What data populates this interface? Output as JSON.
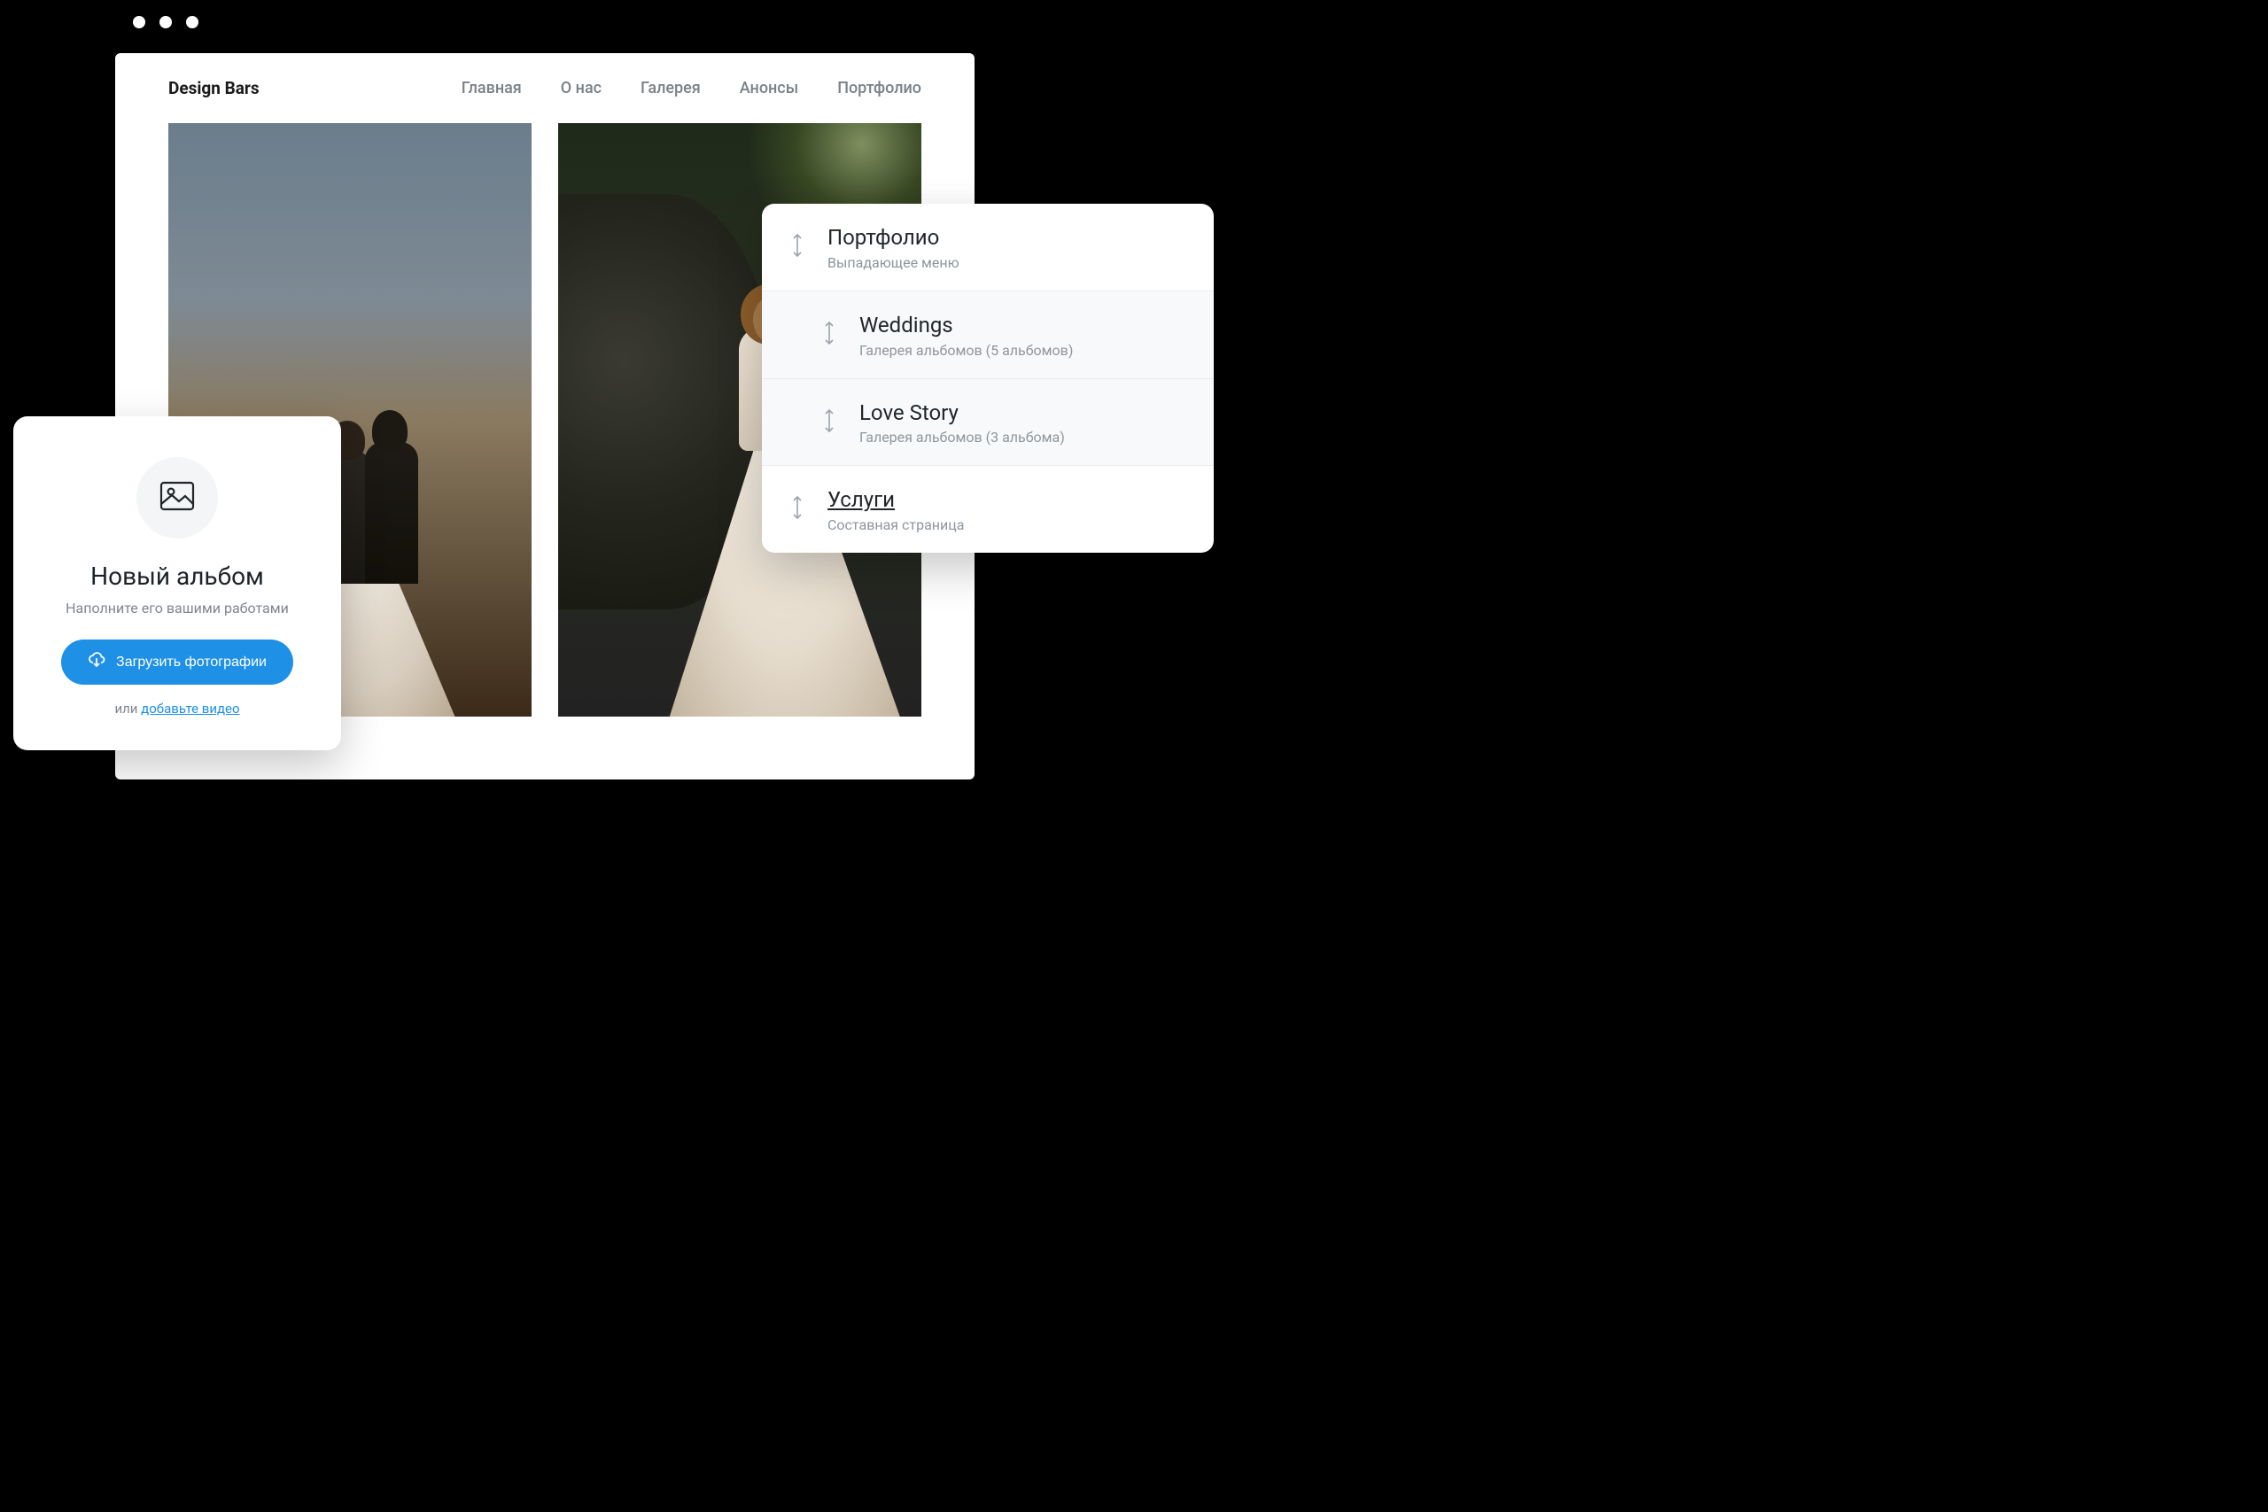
{
  "site": {
    "title": "Design Bars",
    "nav": [
      "Главная",
      "О нас",
      "Галерея",
      "Анонсы",
      "Портфолио"
    ]
  },
  "menu": {
    "items": [
      {
        "title": "Портфолио",
        "subtitle": "Выпадающее меню",
        "indent": false,
        "underlined": false
      },
      {
        "title": "Weddings",
        "subtitle": "Галерея альбомов (5 альбомов)",
        "indent": true,
        "underlined": false
      },
      {
        "title": "Love Story",
        "subtitle": "Галерея альбомов (3 альбома)",
        "indent": true,
        "underlined": false
      },
      {
        "title": "Услуги",
        "subtitle": "Составная страница",
        "indent": false,
        "underlined": true
      }
    ]
  },
  "album": {
    "title": "Новый альбом",
    "subtitle": "Наполните его вашими работами",
    "upload_label": "Загрузить фотографии",
    "or_prefix": "или ",
    "video_link": "добавьте видео"
  },
  "colors": {
    "accent": "#1e90e6"
  }
}
